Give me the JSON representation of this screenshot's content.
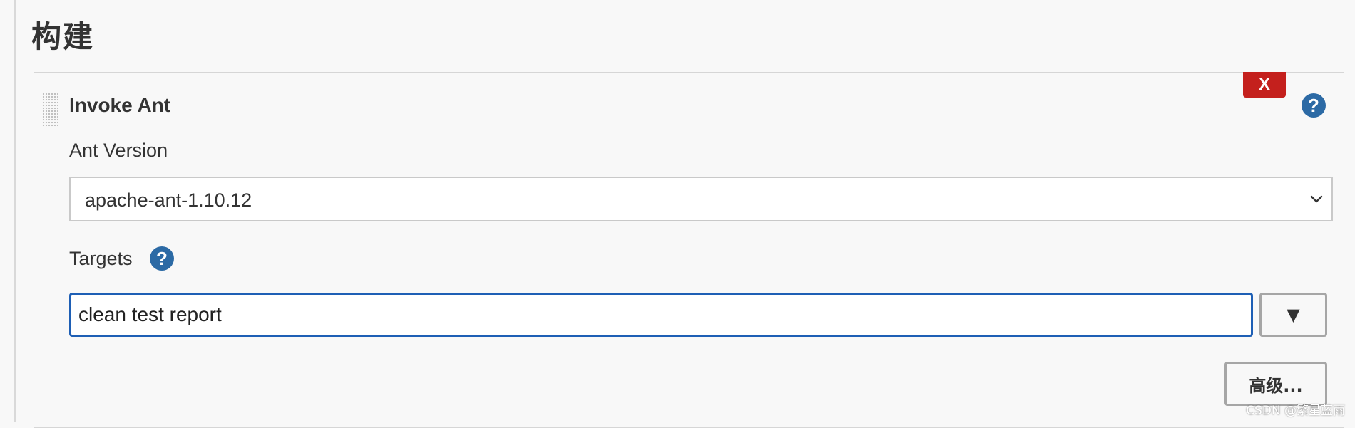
{
  "section": {
    "title": "构建"
  },
  "step": {
    "delete_label": "X",
    "title": "Invoke Ant",
    "help_glyph": "?",
    "help_icon": "question-circle-icon",
    "drag_icon": "drag-handle-icon"
  },
  "ant_version": {
    "label": "Ant Version",
    "selected": "apache-ant-1.10.12",
    "chevron_icon": "chevron-down-icon"
  },
  "targets": {
    "label": "Targets",
    "help_glyph": "?",
    "value": "clean test report",
    "dropdown_glyph": "▼"
  },
  "advanced": {
    "label": "高级..."
  },
  "watermark": {
    "text": "CSDN @繁星蓝雨"
  },
  "colors": {
    "delete_red": "#c4201d",
    "help_blue": "#2c6aa5",
    "focus_blue": "#1e5fb5",
    "background": "#f8f8f8"
  }
}
